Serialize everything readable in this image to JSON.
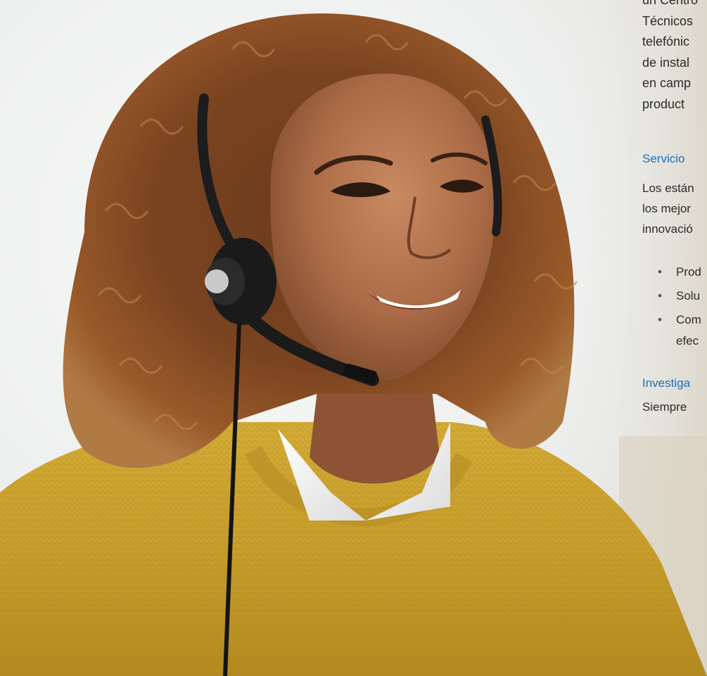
{
  "intro": {
    "lines": [
      "un Centro",
      "Técnicos",
      "telefónic",
      "de instal",
      "en camp",
      "product"
    ]
  },
  "servicio": {
    "heading": "Servicio",
    "lines": [
      "Los están",
      "los mejor",
      "innovació"
    ],
    "bullets": [
      {
        "text": "Prod"
      },
      {
        "text": "Solu"
      },
      {
        "text": "Com",
        "cont": "efec"
      }
    ]
  },
  "investiga": {
    "heading": "Investiga",
    "text": "Siempre"
  },
  "photo": {
    "subject": "smiling woman wearing a headset",
    "sweater_color": "#c8a02a",
    "accent": "#1d6fb8"
  }
}
